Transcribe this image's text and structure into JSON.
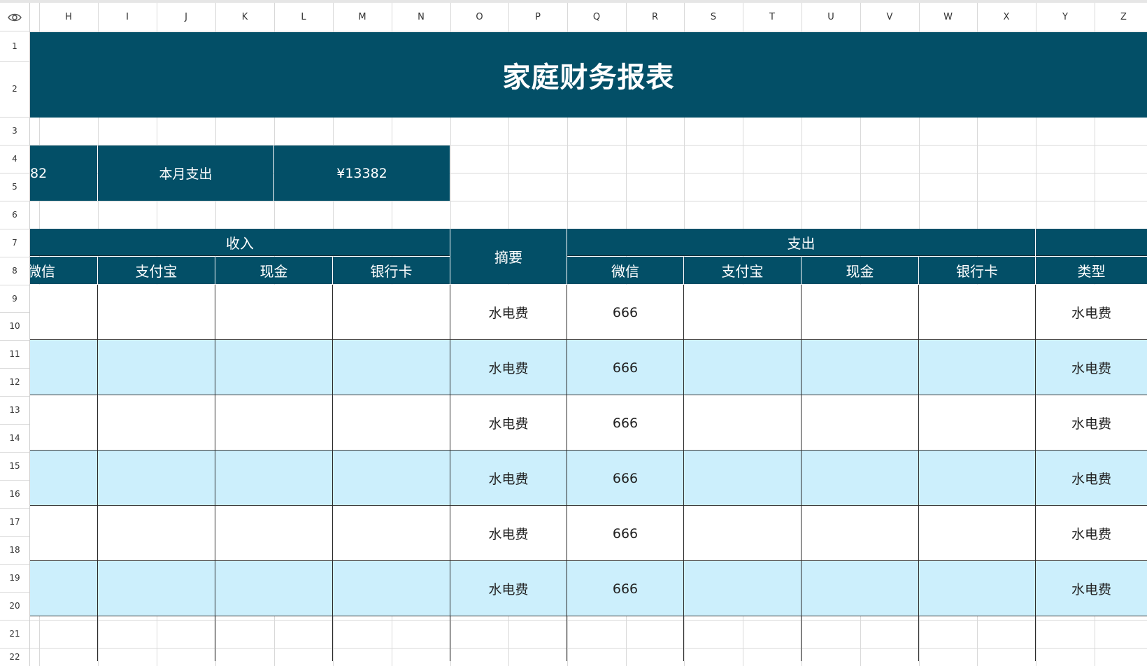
{
  "column_headers": [
    "H",
    "I",
    "J",
    "K",
    "L",
    "M",
    "N",
    "O",
    "P",
    "Q",
    "R",
    "S",
    "T",
    "U",
    "V",
    "W",
    "X",
    "Y",
    "Z"
  ],
  "row_headers": [
    "1",
    "2",
    "3",
    "4",
    "5",
    "6",
    "7",
    "8",
    "9",
    "10",
    "11",
    "12",
    "13",
    "14",
    "15",
    "16",
    "17",
    "18",
    "19",
    "20",
    "21",
    "22"
  ],
  "visibility_icon": "eye-icon",
  "colors": {
    "header_dark": "#034f67",
    "band_light": "#cceffc",
    "grid_line": "#d9d9d9"
  },
  "title": "家庭财务报表",
  "summary": {
    "prev_value_fragment": "82",
    "month_expense_label": "本月支出",
    "month_expense_value": "¥13382"
  },
  "table": {
    "income_group": "收入",
    "summary_header": "摘要",
    "expense_group": "支出",
    "income_columns": [
      "微信",
      "支付宝",
      "现金",
      "银行卡"
    ],
    "expense_columns": [
      "微信",
      "支付宝",
      "现金",
      "银行卡"
    ],
    "type_header": "类型",
    "rows": [
      {
        "summary": "水电费",
        "wechat": "666",
        "type": "水电费"
      },
      {
        "summary": "水电费",
        "wechat": "666",
        "type": "水电费"
      },
      {
        "summary": "水电费",
        "wechat": "666",
        "type": "水电费"
      },
      {
        "summary": "水电费",
        "wechat": "666",
        "type": "水电费"
      },
      {
        "summary": "水电费",
        "wechat": "666",
        "type": "水电费"
      },
      {
        "summary": "水电费",
        "wechat": "666",
        "type": "水电费"
      }
    ]
  }
}
